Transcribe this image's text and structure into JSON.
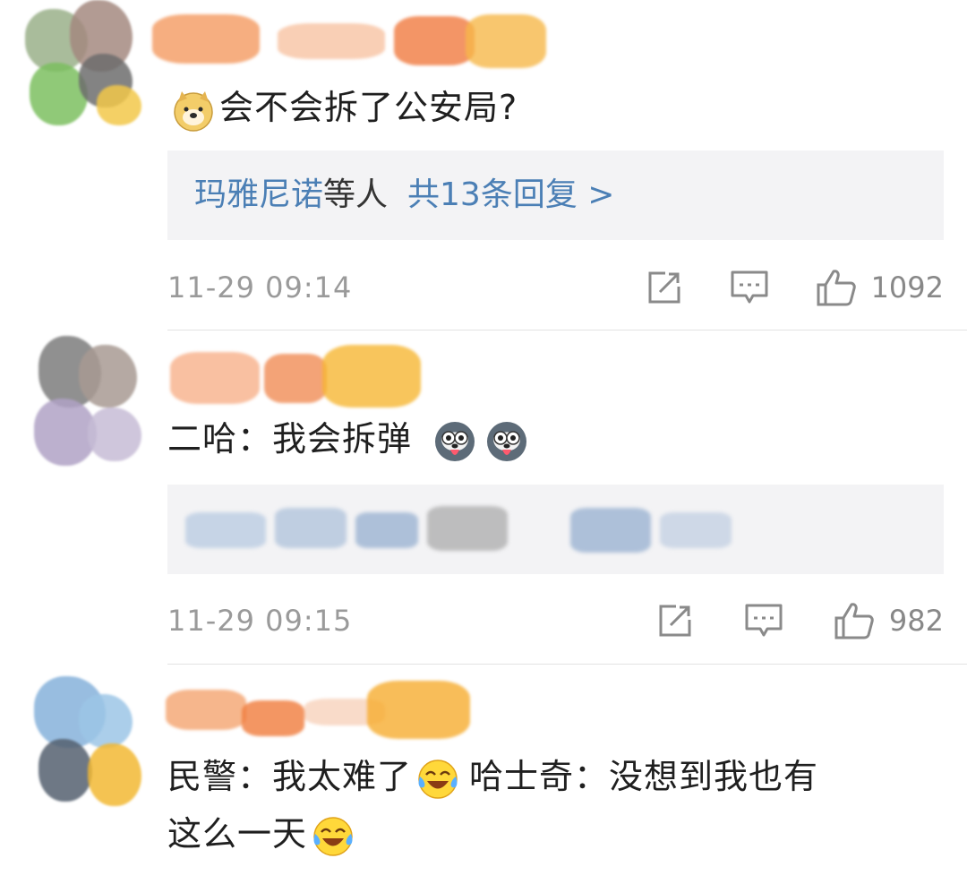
{
  "comments": [
    {
      "text": "会不会拆了公安局?",
      "reply_names": "玛雅尼诺",
      "reply_others": "等人",
      "reply_count": "共13条回复 >",
      "time": "11-29 09:14",
      "likes": "1092"
    },
    {
      "text_prefix": "二哈：我会拆弹",
      "time": "11-29 09:15",
      "likes": "982"
    },
    {
      "text_part1": "民警：我太难了",
      "text_part2": "哈士奇：没想到我也有",
      "text_part3": "这么一天"
    }
  ],
  "icons": {
    "share": "share-icon",
    "comment": "comment-icon",
    "like": "thumbs-up-icon",
    "doge": "doge-emoji-icon",
    "husky": "husky-emoji-icon",
    "laugh_cry": "laugh-cry-emoji-icon"
  },
  "colors": {
    "link": "#4b7fb5",
    "meta": "#9a9a9a",
    "reply_bg": "#f3f3f5"
  }
}
